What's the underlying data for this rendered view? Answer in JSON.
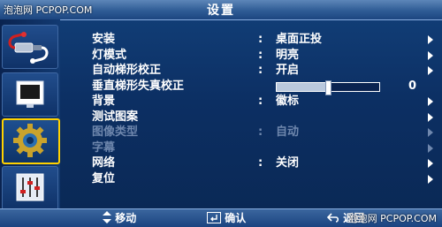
{
  "watermark_top": "泡泡网 PCPOP.COM",
  "title": "设置",
  "menu": [
    {
      "label": "安装",
      "value": "桌面正投",
      "disabled": false
    },
    {
      "label": "灯模式",
      "value": "明亮",
      "disabled": false
    },
    {
      "label": "自动梯形校正",
      "value": "开启",
      "disabled": false
    },
    {
      "label": "垂直梯形失真校正",
      "slider_level": 0.5,
      "slider_value": "0",
      "disabled": false
    },
    {
      "label": "背景",
      "value": "徽标",
      "disabled": false
    },
    {
      "label": "测试图案",
      "value": "",
      "disabled": false
    },
    {
      "label": "图像类型",
      "value": "自动",
      "disabled": true
    },
    {
      "label": "字幕",
      "value": "",
      "disabled": true
    },
    {
      "label": "网络",
      "value": "关闭",
      "disabled": false
    },
    {
      "label": "复位",
      "value": "",
      "disabled": false
    }
  ],
  "bottom": {
    "move_label": "移动",
    "enter_label": "确认",
    "return_label": "返回"
  },
  "watermark_bottom": "泡泡网 PCPOP.COM",
  "colors": {
    "selected_border": "#ffd200",
    "disabled_text": "#6f87ad",
    "background": "#0c2f63"
  },
  "icons": [
    "input-plug-icon",
    "picture-screen-icon",
    "settings-gear-icon",
    "equalizer-sliders-icon"
  ]
}
